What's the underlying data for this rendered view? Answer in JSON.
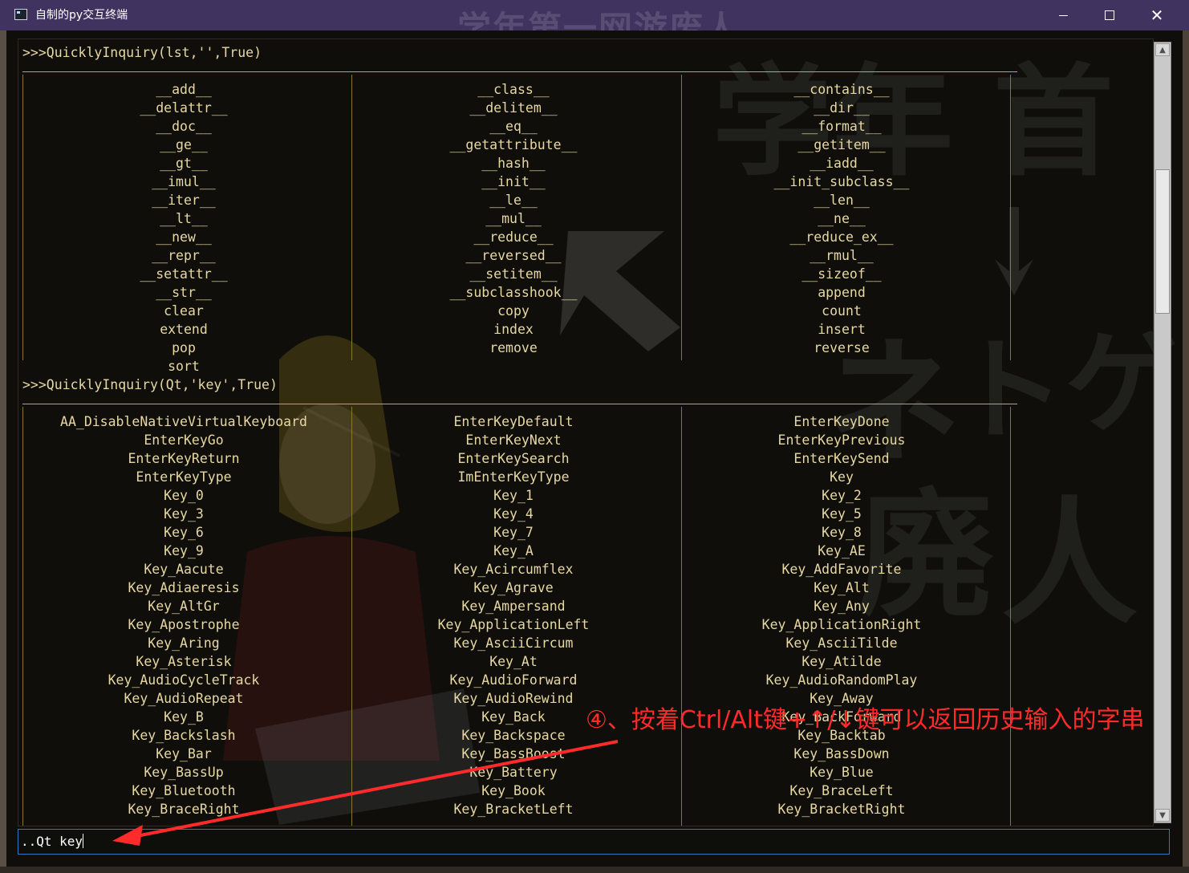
{
  "window": {
    "title": "自制的py交互终端",
    "watermark": "学年第一网游废人",
    "controls": {
      "minimize": "minimize-icon",
      "maximize": "maximize-icon",
      "close": "close-icon"
    }
  },
  "background_art": {
    "chars": [
      "学",
      "年",
      "首",
      "ネ",
      "ト",
      "ゲ",
      "廃",
      "人"
    ]
  },
  "session": [
    {
      "prompt": ">>>QuicklyInquiry(lst,'',True)",
      "rows": [
        [
          "__add__",
          "__class__",
          "__contains__"
        ],
        [
          "__delattr__",
          "__delitem__",
          "__dir__"
        ],
        [
          "__doc__",
          "__eq__",
          "__format__"
        ],
        [
          "__ge__",
          "__getattribute__",
          "__getitem__"
        ],
        [
          "__gt__",
          "__hash__",
          "__iadd__"
        ],
        [
          "__imul__",
          "__init__",
          "__init_subclass__"
        ],
        [
          "__iter__",
          "__le__",
          "__len__"
        ],
        [
          "__lt__",
          "__mul__",
          "__ne__"
        ],
        [
          "__new__",
          "__reduce__",
          "__reduce_ex__"
        ],
        [
          "__repr__",
          "__reversed__",
          "__rmul__"
        ],
        [
          "__setattr__",
          "__setitem__",
          "__sizeof__"
        ],
        [
          "__str__",
          "__subclasshook__",
          "append"
        ],
        [
          "clear",
          "copy",
          "count"
        ],
        [
          "extend",
          "index",
          "insert"
        ],
        [
          "pop",
          "remove",
          "reverse"
        ],
        [
          "sort",
          "",
          ""
        ]
      ]
    },
    {
      "prompt": ">>>QuicklyInquiry(Qt,'key',True)",
      "rows": [
        [
          "AA_DisableNativeVirtualKeyboard",
          "EnterKeyDefault",
          "EnterKeyDone"
        ],
        [
          "EnterKeyGo",
          "EnterKeyNext",
          "EnterKeyPrevious"
        ],
        [
          "EnterKeyReturn",
          "EnterKeySearch",
          "EnterKeySend"
        ],
        [
          "EnterKeyType",
          "ImEnterKeyType",
          "Key"
        ],
        [
          "Key_0",
          "Key_1",
          "Key_2"
        ],
        [
          "Key_3",
          "Key_4",
          "Key_5"
        ],
        [
          "Key_6",
          "Key_7",
          "Key_8"
        ],
        [
          "Key_9",
          "Key_A",
          "Key_AE"
        ],
        [
          "Key_Aacute",
          "Key_Acircumflex",
          "Key_AddFavorite"
        ],
        [
          "Key_Adiaeresis",
          "Key_Agrave",
          "Key_Alt"
        ],
        [
          "Key_AltGr",
          "Key_Ampersand",
          "Key_Any"
        ],
        [
          "Key_Apostrophe",
          "Key_ApplicationLeft",
          "Key_ApplicationRight"
        ],
        [
          "Key_Aring",
          "Key_AsciiCircum",
          "Key_AsciiTilde"
        ],
        [
          "Key_Asterisk",
          "Key_At",
          "Key_Atilde"
        ],
        [
          "Key_AudioCycleTrack",
          "Key_AudioForward",
          "Key_AudioRandomPlay"
        ],
        [
          "Key_AudioRepeat",
          "Key_AudioRewind",
          "Key_Away"
        ],
        [
          "Key_B",
          "Key_Back",
          "Key_BackForward"
        ],
        [
          "Key_Backslash",
          "Key_Backspace",
          "Key_Backtab"
        ],
        [
          "Key_Bar",
          "Key_BassBoost",
          "Key_BassDown"
        ],
        [
          "Key_BassUp",
          "Key_Battery",
          "Key_Blue"
        ],
        [
          "Key_Bluetooth",
          "Key_Book",
          "Key_BraceLeft"
        ],
        [
          "Key_BraceRight",
          "Key_BracketLeft",
          "Key_BracketRight"
        ]
      ]
    }
  ],
  "input": {
    "value": "..Qt key"
  },
  "annotation": {
    "text": "④、按着Ctrl/Alt键+↑/↓键可以返回历史输入的字串",
    "color": "#ff2b2b"
  },
  "colors": {
    "terminal_text": "#e7d8a3",
    "separator": "#c3a746",
    "title_bar": "#41335f",
    "input_border": "#2f76c7"
  }
}
